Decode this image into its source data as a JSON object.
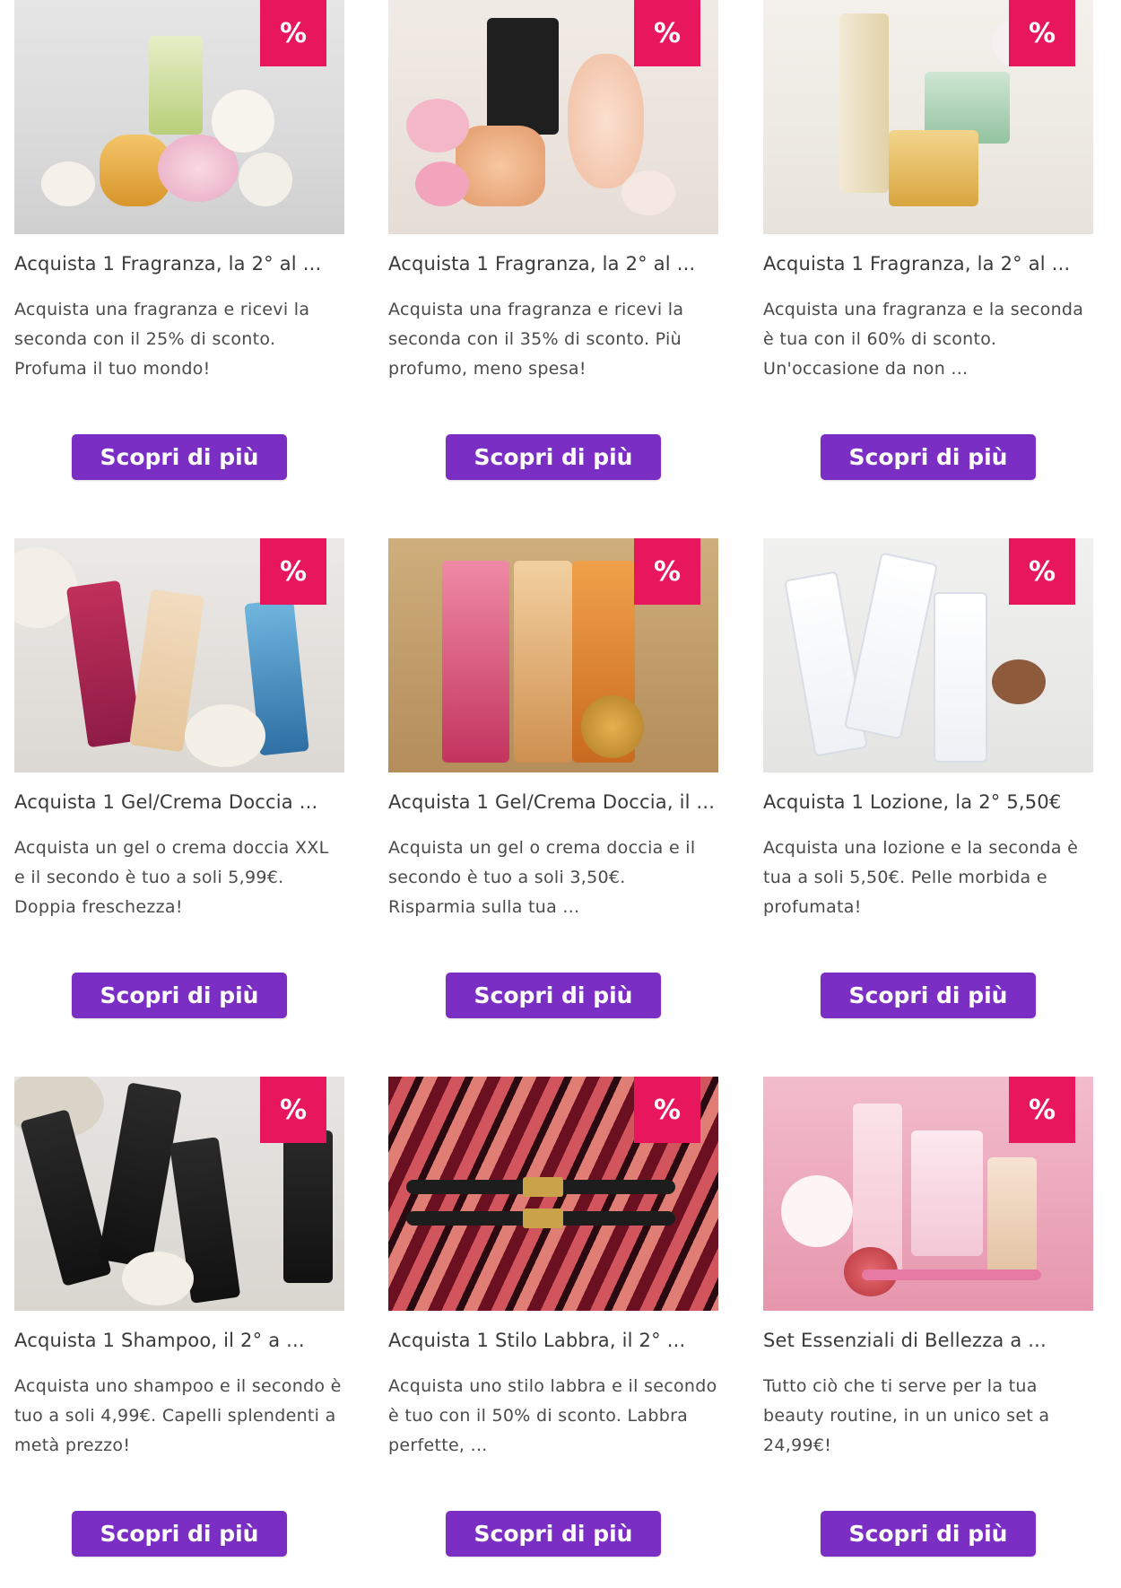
{
  "badge_symbol": "%",
  "button_label": "Scopri di più",
  "colors": {
    "badge": "#e8175d",
    "button": "#7a2ec4"
  },
  "cards": [
    {
      "title": "Acquista 1 Fragranza, la 2° al ...",
      "description": "Acquista una fragranza e ricevi la seconda con il 25% di sconto. Profuma il tuo mondo!",
      "image": "perfume-bottles-with-white-roses"
    },
    {
      "title": "Acquista 1 Fragranza, la 2° al ...",
      "description": "Acquista una fragranza e ricevi la seconda con il 35% di sconto. Più profumo, meno spesa!",
      "image": "perfume-bottles-with-pink-flowers"
    },
    {
      "title": "Acquista 1 Fragranza, la 2° al ...",
      "description": "Acquista una fragranza e la seconda è tua con il 60% di sconto. Un'occasione da non ...",
      "image": "gold-and-green-perfume-bottles"
    },
    {
      "title": "Acquista 1 Gel/Crema Doccia ...",
      "description": "Acquista un gel o crema doccia XXL e il secondo è tuo a soli 5,99€. Doppia freschezza!",
      "image": "shower-gel-bottles"
    },
    {
      "title": "Acquista 1 Gel/Crema Doccia, il ...",
      "description": "Acquista un gel o crema doccia e il secondo è tuo a soli 3,50€. Risparmia sulla tua ...",
      "image": "shower-gel-bottles-with-sponge"
    },
    {
      "title": "Acquista 1 Lozione, la 2° 5,50€",
      "description": "Acquista una lozione e la seconda è tua a soli 5,50€. Pelle morbida e profumata!",
      "image": "care-lotion-bottles"
    },
    {
      "title": "Acquista 1 Shampoo, il 2° a ...",
      "description": "Acquista uno shampoo e il secondo è tuo a soli 4,99€. Capelli splendenti a metà prezzo!",
      "image": "black-shampoo-bottles"
    },
    {
      "title": "Acquista 1 Stilo Labbra, il 2° ...",
      "description": "Acquista uno stilo labbra e il secondo è tuo con il 50% di sconto. Labbra perfette, ...",
      "image": "lip-liner-pencils-on-stripes"
    },
    {
      "title": "Set Essenziali di Bellezza a ...",
      "description": "Tutto ciò che ti serve per la tua beauty routine, in un unico set a 24,99€!",
      "image": "beauty-set-on-pink-background"
    }
  ]
}
